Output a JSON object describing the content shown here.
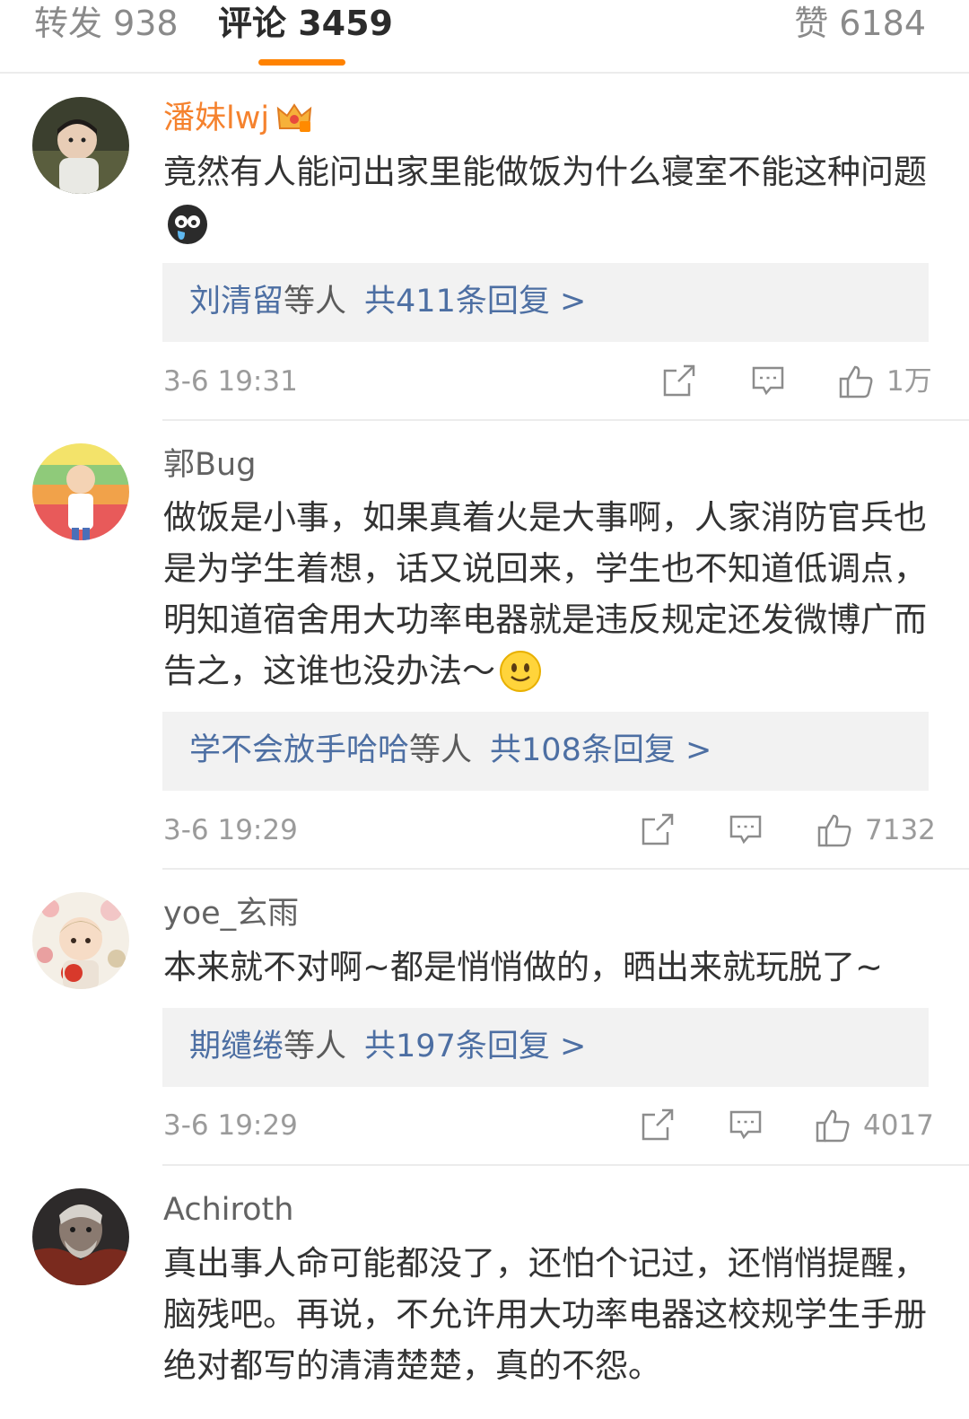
{
  "tabs": {
    "repost": "转发 938",
    "comments": "评论 3459",
    "likes": "赞 6184",
    "active_color": "#ff8200"
  },
  "comments": [
    {
      "user": "潘妹lwj",
      "user_badge": "crown-badge-icon",
      "text": "竟然有人能问出家里能做饭为什么寝室不能这种问题",
      "emoji": "crying-face-icon",
      "reply_names": "刘清留",
      "reply_mid": "等人",
      "reply_count": "共411条回复 >",
      "time": "3-6 19:31",
      "likes": "1万"
    },
    {
      "user": "郭Bug",
      "text": "做饭是小事，如果真着火是大事啊，人家消防官兵也是为学生着想，话又说回来，学生也不知道低调点，明知道宿舍用大功率电器就是违反规定还发微博广而告之，这谁也没办法～",
      "emoji": "smile-face-icon",
      "reply_names": "学不会放手哈哈",
      "reply_mid": "等人",
      "reply_count": "共108条回复 >",
      "time": "3-6 19:29",
      "likes": "7132"
    },
    {
      "user": "yoe_玄雨",
      "text": "本来就不对啊~都是悄悄做的，晒出来就玩脱了~",
      "reply_names": "期缱绻",
      "reply_mid": "等人",
      "reply_count": "共197条回复 >",
      "time": "3-6 19:29",
      "likes": "4017"
    },
    {
      "user": "Achiroth",
      "text": "真出事人命可能都没了，还怕个记过，还悄悄提醒，脑残吧。再说，不允许用大功率电器这校规学生手册绝对都写的清清楚楚，真的不怨。"
    }
  ],
  "icons": {
    "share": "share-icon",
    "comment": "comment-icon",
    "like": "thumbs-up-icon"
  },
  "colors": {
    "username_highlight": "#f5822e",
    "reply_link": "#4d6fa3",
    "reply_box_bg": "#f2f2f2"
  }
}
